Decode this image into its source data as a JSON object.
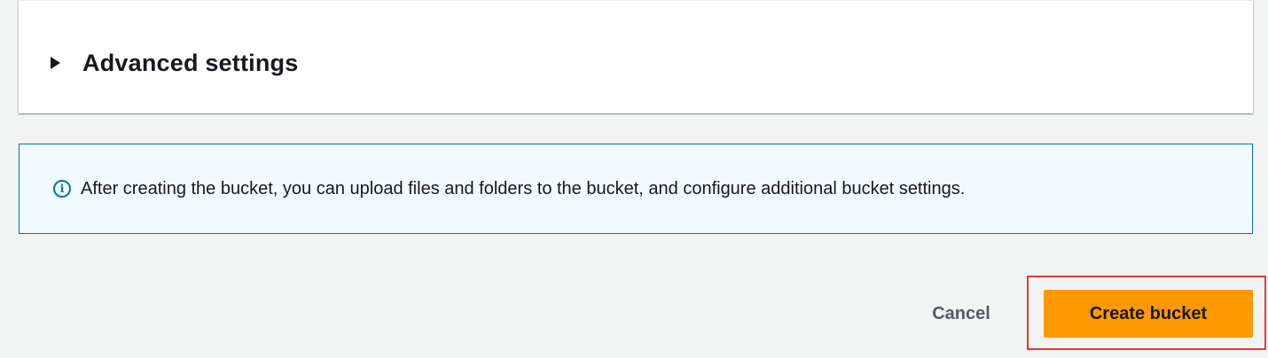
{
  "advanced_settings": {
    "title": "Advanced settings",
    "expanded": false,
    "icon": "caret-right-icon"
  },
  "info_alert": {
    "icon": "info-icon",
    "icon_glyph": "i",
    "message": "After creating the bucket, you can upload files and folders to the bucket, and configure additional bucket settings.",
    "border_color": "#0073bb",
    "background_color": "#f1faff"
  },
  "actions": {
    "cancel_label": "Cancel",
    "create_label": "Create bucket",
    "primary_color": "#ff9900",
    "highlight_color": "#e53935"
  }
}
